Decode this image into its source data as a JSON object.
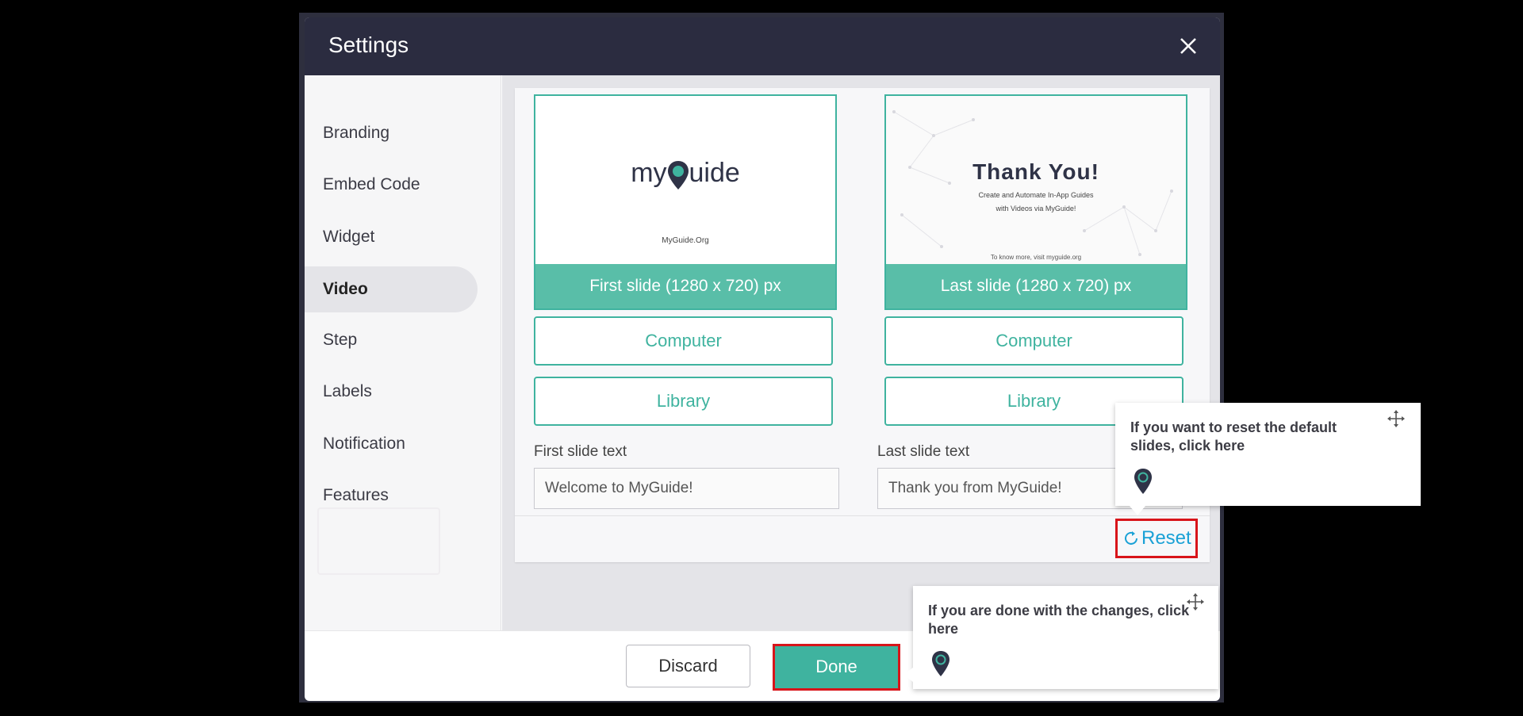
{
  "dialog": {
    "title": "Settings"
  },
  "sidebar": {
    "items": [
      {
        "label": "Branding"
      },
      {
        "label": "Embed Code"
      },
      {
        "label": "Widget"
      },
      {
        "label": "Video"
      },
      {
        "label": "Step"
      },
      {
        "label": "Labels"
      },
      {
        "label": "Notification"
      },
      {
        "label": "Features"
      }
    ],
    "active": "Video"
  },
  "first_slide": {
    "logo_text_left": "my",
    "logo_text_right": "uide",
    "footer_text": "MyGuide.Org",
    "caption": "First slide (1280 x 720) px",
    "computer_label": "Computer",
    "library_label": "Library",
    "text_label": "First slide text",
    "text_value": "Welcome to MyGuide!"
  },
  "last_slide": {
    "heading": "Thank You!",
    "subtitle_line1": "Create and Automate In-App Guides",
    "subtitle_line2": "with Videos via MyGuide!",
    "footer_text": "To know more, visit myguide.org",
    "caption": "Last slide (1280 x 720) px",
    "computer_label": "Computer",
    "library_label": "Library",
    "text_label": "Last slide text",
    "text_value": "Thank you from MyGuide!"
  },
  "actions": {
    "reset_label": "Reset",
    "discard_label": "Discard",
    "done_label": "Done"
  },
  "tooltips": {
    "reset": {
      "text": "If you want to reset the default slides, click here"
    },
    "done": {
      "text": "If you are done with the changes, click here"
    }
  },
  "colors": {
    "accent": "#3fb39f",
    "header": "#2b2c40",
    "highlight": "#d8141a",
    "link": "#1aa1d6"
  },
  "icons": {
    "close": "close-icon",
    "reset": "refresh-icon",
    "move": "move-icon",
    "logo": "myguide-pin-icon"
  }
}
